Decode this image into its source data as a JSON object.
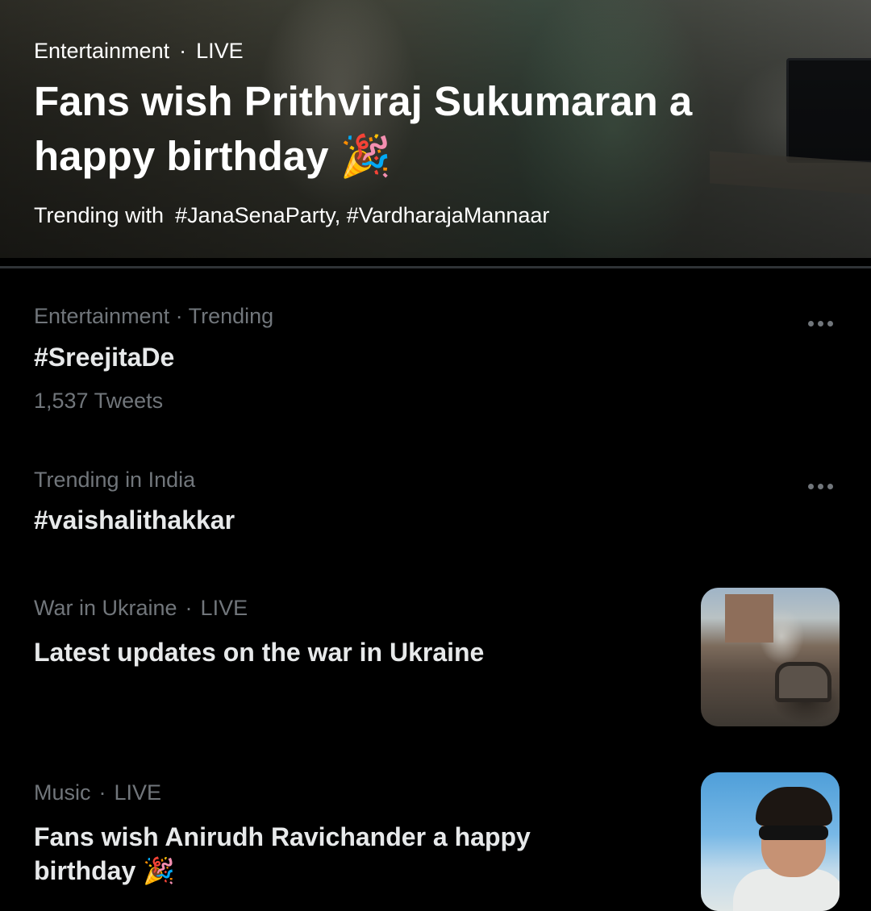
{
  "hero": {
    "category": "Entertainment",
    "separator": "·",
    "status": "LIVE",
    "title_line1": "Fans wish Prithviraj Sukumaran a",
    "title_line2": "happy birthday",
    "emoji": "🎉",
    "trending_label": "Trending with",
    "trending_tags": "#JanaSenaParty, #VardharajaMannaar"
  },
  "trends": [
    {
      "category": "Entertainment · Trending",
      "title": "#SreejitaDe",
      "count": "1,537 Tweets",
      "more_icon": "more-horizontal-icon"
    },
    {
      "category": "Trending in India",
      "title": "#vaishalithakkar",
      "more_icon": "more-horizontal-icon"
    },
    {
      "category": "War in Ukraine",
      "separator": "·",
      "status": "LIVE",
      "title": "Latest updates on the war in Ukraine"
    },
    {
      "category": "Music",
      "separator": "·",
      "status": "LIVE",
      "title": "Fans wish Anirudh Ravichander a happy",
      "title_line2": "birthday",
      "emoji": "🎉"
    }
  ],
  "colors": {
    "background": "#000000",
    "primary_text": "#e7e9ea",
    "secondary_text": "#71767b",
    "divider": "#2f3336"
  }
}
